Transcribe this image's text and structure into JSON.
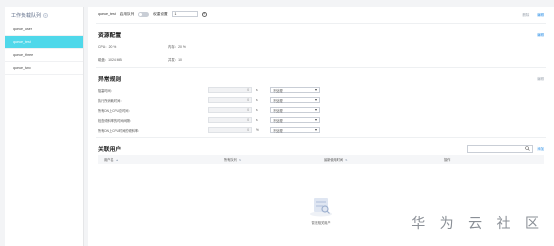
{
  "sidebar": {
    "title": "工作负载队列",
    "items": [
      {
        "label": "queue_user"
      },
      {
        "label": "queue_test"
      },
      {
        "label": "queue_three"
      },
      {
        "label": "queue_two"
      }
    ]
  },
  "topbar": {
    "queue_name": "queue_test",
    "toggle_label": "启用队列",
    "limit_label": "权重设置",
    "limit_value": "1",
    "links": [
      "删除",
      "编辑"
    ]
  },
  "resource": {
    "title": "资源配置",
    "edit": "编辑",
    "cpu_label": "CPU：",
    "cpu_value": "20 %",
    "memory_label": "内存：",
    "memory_value": "20 %",
    "storage_label": "磁盘：",
    "storage_value": "1024 MB",
    "concurrency_label": "并发：",
    "concurrency_value": "10"
  },
  "exception": {
    "title": "异常规则",
    "edit": "编辑",
    "rows": [
      {
        "label": "阻塞时间：",
        "value": "0",
        "unit": "s",
        "select": "不处理"
      },
      {
        "label": "执行所消耗时间：",
        "value": "0",
        "unit": "s",
        "select": "不处理"
      },
      {
        "label": "所有DN上CPU总时间：",
        "value": "0",
        "unit": "s",
        "select": "不处理"
      },
      {
        "label": "检查倾斜率的时间间隔：",
        "value": "0",
        "unit": "s",
        "select": "不处理"
      },
      {
        "label": "所有DN上CPU时间的倾斜率：",
        "value": "0",
        "unit": "%",
        "select": "不处理"
      }
    ]
  },
  "users": {
    "title": "关联用户",
    "add": "添加",
    "columns": [
      "用户名",
      "所有队列",
      "最新使用时间",
      "操作"
    ],
    "empty_text": "暂无相关用户"
  },
  "watermark": "华 为 云 社 区"
}
